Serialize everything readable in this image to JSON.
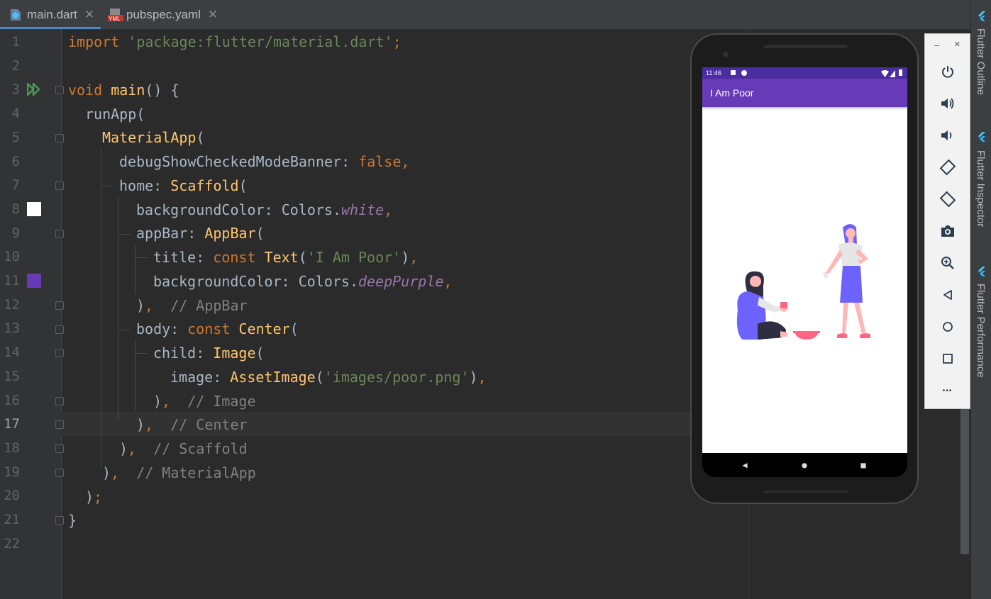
{
  "tabs": [
    {
      "label": "main.dart",
      "icon": "dart-file-icon",
      "active": true
    },
    {
      "label": "pubspec.yaml",
      "icon": "yaml-file-icon",
      "active": false
    }
  ],
  "editor": {
    "current_line": 17,
    "lines": [
      "1",
      "2",
      "3",
      "4",
      "5",
      "6",
      "7",
      "8",
      "9",
      "10",
      "11",
      "12",
      "13",
      "14",
      "15",
      "16",
      "17",
      "18",
      "19",
      "20",
      "21",
      "22"
    ],
    "code": {
      "l1": {
        "kw": "import",
        "str": "'package:flutter/material.dart'",
        "semi": ";"
      },
      "l3": {
        "kw": "void",
        "fn": "main",
        "rest": "() {"
      },
      "l4": {
        "text": "runApp("
      },
      "l5": {
        "cls": "MaterialApp",
        "rest": "("
      },
      "l6": {
        "prop": "debugShowCheckedModeBanner: ",
        "kw": "false",
        "comma": ","
      },
      "l7": {
        "prop": "home: ",
        "cls": "Scaffold",
        "rest": "("
      },
      "l8": {
        "prop": "backgroundColor: Colors.",
        "it": "white",
        "comma": ","
      },
      "l9": {
        "prop": "appBar: ",
        "cls": "AppBar",
        "rest": "("
      },
      "l10": {
        "prop": "title: ",
        "kw": "const ",
        "cls": "Text",
        "open": "(",
        "str": "'I Am Poor'",
        "close": ")",
        "comma": ","
      },
      "l11": {
        "prop": "backgroundColor: Colors.",
        "it": "deepPurple",
        "comma": ","
      },
      "l12": {
        "close": ")",
        "comma": ",",
        "comment": "// AppBar"
      },
      "l13": {
        "prop": "body: ",
        "kw": "const ",
        "cls": "Center",
        "rest": "("
      },
      "l14": {
        "prop": "child: ",
        "cls": "Image",
        "rest": "("
      },
      "l15": {
        "prop": "image: ",
        "cls": "AssetImage",
        "open": "(",
        "str": "'images/poor.png'",
        "close": ")",
        "comma": ","
      },
      "l16": {
        "close": ")",
        "comma": ",",
        "comment": "// Image"
      },
      "l17": {
        "close": ")",
        "comma": ",",
        "comment": "// Center"
      },
      "l18": {
        "close": ")",
        "comma": ",",
        "comment": "// Scaffold"
      },
      "l19": {
        "close": ")",
        "comma": ",",
        "comment": "// MaterialApp"
      },
      "l20": {
        "close": ")",
        "semi": ";"
      },
      "l21": {
        "text": "}"
      }
    },
    "gutter_colors": {
      "l8": "#ffffff",
      "l11": "#673ab7"
    }
  },
  "emulator": {
    "status_time": "11:46",
    "appbar_title": "I Am Poor",
    "appbar_color": "#673ab7",
    "nav": {
      "back": "◀",
      "home": "●",
      "recents": "■"
    }
  },
  "emulator_toolbar": {
    "minimize": "–",
    "close": "×",
    "more": "•••",
    "tools": [
      "power-icon",
      "volume-up-icon",
      "volume-down-icon",
      "rotate-left-icon",
      "rotate-right-icon",
      "camera-icon",
      "zoom-icon",
      "back-icon",
      "home-icon",
      "overview-icon",
      "more-icon"
    ]
  },
  "side_panel": [
    "Flutter Outline",
    "Flutter Inspector",
    "Flutter Performance"
  ]
}
